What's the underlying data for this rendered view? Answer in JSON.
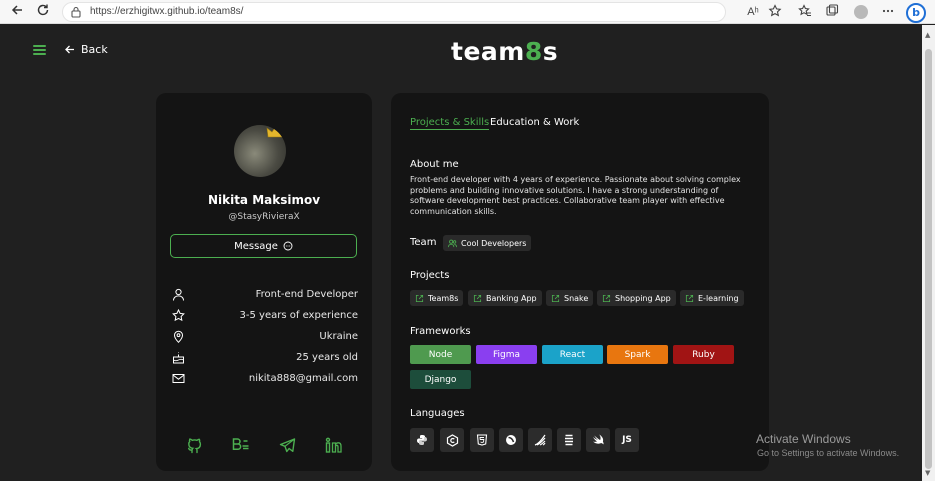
{
  "browser": {
    "url": "https://erzhigitwx.github.io/team8s/",
    "reader_label": "Aʰ"
  },
  "header": {
    "back_label": "Back",
    "logo_prefix": "team",
    "logo_digit": "8",
    "logo_suffix": "s"
  },
  "profile": {
    "name": "Nikita Maksimov",
    "handle": "@StasyRivieraX",
    "message_label": "Message",
    "info": [
      {
        "icon": "user-icon",
        "value": "Front-end Developer"
      },
      {
        "icon": "star-icon",
        "value": "3-5 years of experience"
      },
      {
        "icon": "location-icon",
        "value": "Ukraine"
      },
      {
        "icon": "cake-icon",
        "value": "25 years old"
      },
      {
        "icon": "mail-icon",
        "value": "nikita888@gmail.com"
      }
    ],
    "socials": [
      "github-icon",
      "behance-icon",
      "telegram-icon",
      "linkedin-icon"
    ]
  },
  "tabs": {
    "active": "Projects & Skills",
    "inactive": "Education & Work"
  },
  "about": {
    "title": "About me",
    "text": "Front-end developer with 4 years of experience. Passionate about solving complex problems and building innovative solutions. I have a strong understanding of software development best practices. Collaborative team player with effective communication skills."
  },
  "team": {
    "title": "Team",
    "name": "Cool Developers"
  },
  "projects": {
    "title": "Projects",
    "items": [
      "Team8s",
      "Banking App",
      "Snake",
      "Shopping App",
      "E-learning"
    ]
  },
  "frameworks": {
    "title": "Frameworks",
    "items": [
      {
        "label": "Node",
        "color": "#4f9a4f"
      },
      {
        "label": "Figma",
        "color": "#8a3ff0"
      },
      {
        "label": "React",
        "color": "#1ba3c9"
      },
      {
        "label": "Spark",
        "color": "#e8760f"
      },
      {
        "label": "Ruby",
        "color": "#a11414"
      },
      {
        "label": "Django",
        "color": "#1d4d3b"
      }
    ]
  },
  "languages": {
    "title": "Languages",
    "items": [
      "python-icon",
      "c-icon",
      "html5-icon",
      "vue-icon",
      "java-icon",
      "css-icon",
      "swift-icon",
      "js-icon"
    ],
    "js_label": "JS"
  },
  "watermark": {
    "title": "Activate Windows",
    "subtitle": "Go to Settings to activate Windows."
  },
  "colors": {
    "accent": "#4caf50",
    "background": "#202020",
    "card": "#141414"
  }
}
